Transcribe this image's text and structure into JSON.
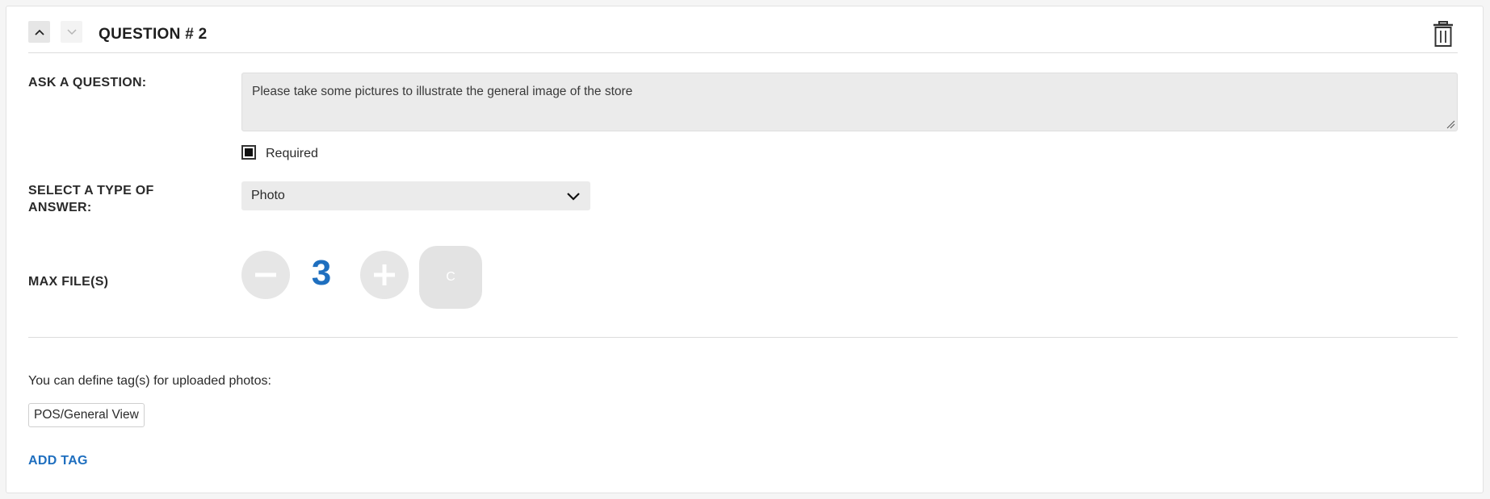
{
  "question": {
    "title": "QUESTION # 2",
    "move_up_icon": "chevron-up-icon",
    "move_down_icon": "chevron-down-icon",
    "delete_icon": "trash-icon"
  },
  "ask": {
    "label": "ASK A QUESTION:",
    "value": "Please take some pictures to illustrate the general image of the store",
    "required_label": "Required",
    "required_checked": true
  },
  "answer_type": {
    "label_line1": "SELECT A TYPE OF",
    "label_line2": "ANSWER:",
    "selected": "Photo"
  },
  "max_files": {
    "label": "MAX FILE(S)",
    "value": "3",
    "clear_label": "C"
  },
  "tags": {
    "info": "You can define tag(s) for uploaded photos:",
    "items": [
      "POS/General View"
    ],
    "add_label": "ADD TAG"
  },
  "colors": {
    "accent": "#1f6fbf",
    "input_bg": "#ebebeb"
  }
}
